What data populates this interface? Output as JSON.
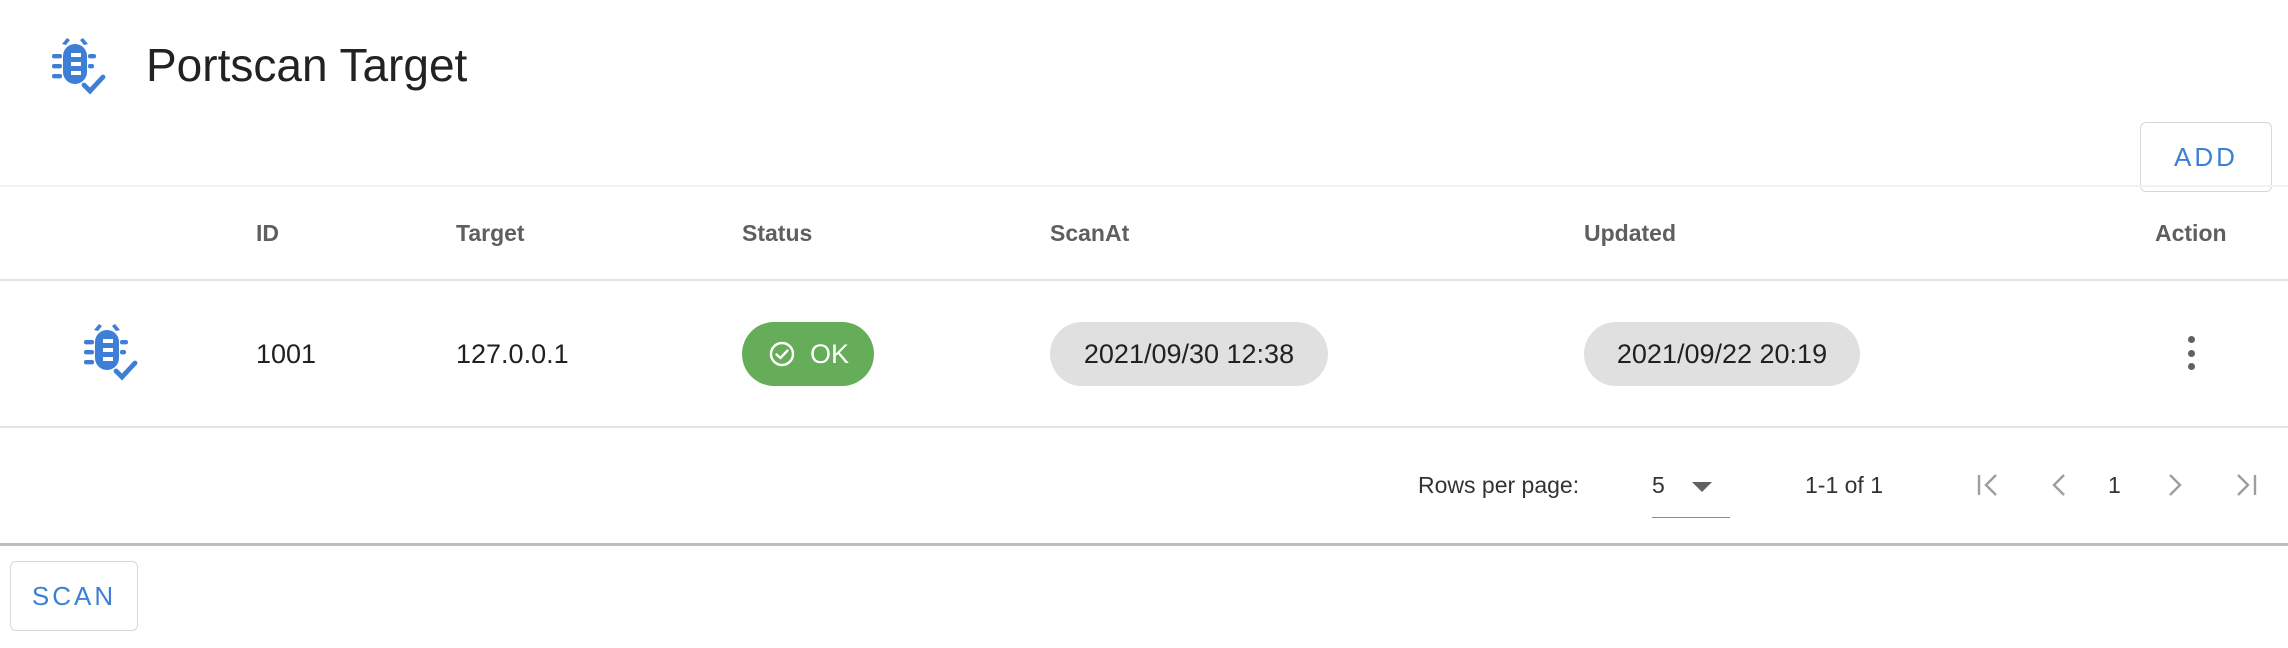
{
  "header": {
    "title": "Portscan Target",
    "icon": "bug-check-icon",
    "accent": "#3d7fd6"
  },
  "toolbar": {
    "add_label": "ADD"
  },
  "table": {
    "columns": [
      "ID",
      "Target",
      "Status",
      "ScanAt",
      "Updated",
      "Action"
    ],
    "rows": [
      {
        "icon": "bug-check-icon",
        "id": "1001",
        "target": "127.0.0.1",
        "status": "OK",
        "scan_at": "2021/09/30 12:38",
        "updated": "2021/09/22 20:19"
      }
    ]
  },
  "pagination": {
    "rows_per_page_label": "Rows per page:",
    "rows_per_page": "5",
    "range": "1-1 of 1",
    "page": "1"
  },
  "footer": {
    "scan_label": "SCAN"
  },
  "colors": {
    "ok": "#66ad59",
    "chip": "#e0e0e0",
    "accent": "#3d7fd6"
  }
}
